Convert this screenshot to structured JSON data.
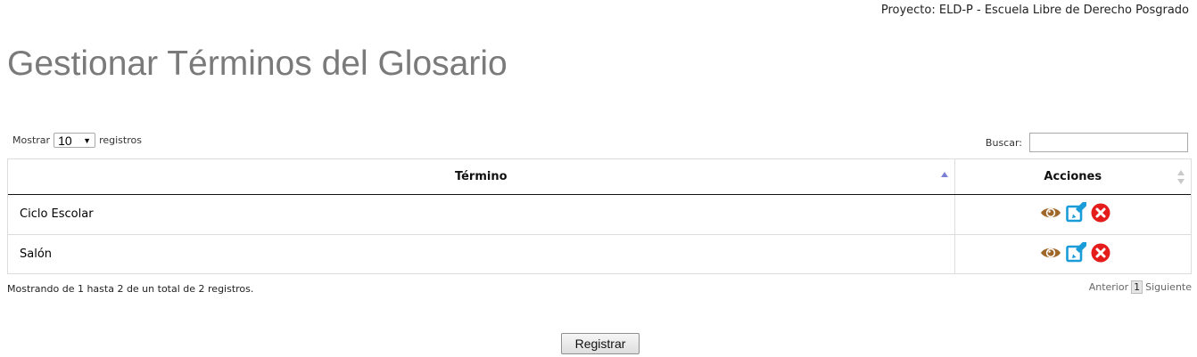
{
  "header": {
    "project": "Proyecto: ELD-P - Escuela Libre de Derecho Posgrado",
    "title": "Gestionar Términos del Glosario"
  },
  "controls": {
    "length_prefix": "Mostrar",
    "length_value": "10",
    "length_suffix": "registros",
    "search_label": "Buscar:",
    "search_value": ""
  },
  "table": {
    "headers": [
      "Término",
      "Acciones"
    ],
    "rows": [
      {
        "termino": "Ciclo Escolar",
        "actions": [
          "view-icon",
          "edit-icon",
          "delete-icon"
        ]
      },
      {
        "termino": "Salón",
        "actions": [
          "view-icon",
          "edit-icon",
          "delete-icon"
        ]
      }
    ]
  },
  "footer": {
    "info": "Mostrando de 1 hasta 2 de un total de 2 registros.",
    "prev": "Anterior",
    "current_page": "1",
    "next": "Siguiente"
  },
  "register_label": "Registrar",
  "colors": {
    "title": "#7a7a7a",
    "view": "#a0672a",
    "edit": "#1a9cd8",
    "delete": "#e51c1c",
    "sort_active": "#7a7fd4",
    "sort_inactive": "#c8c8c8"
  }
}
